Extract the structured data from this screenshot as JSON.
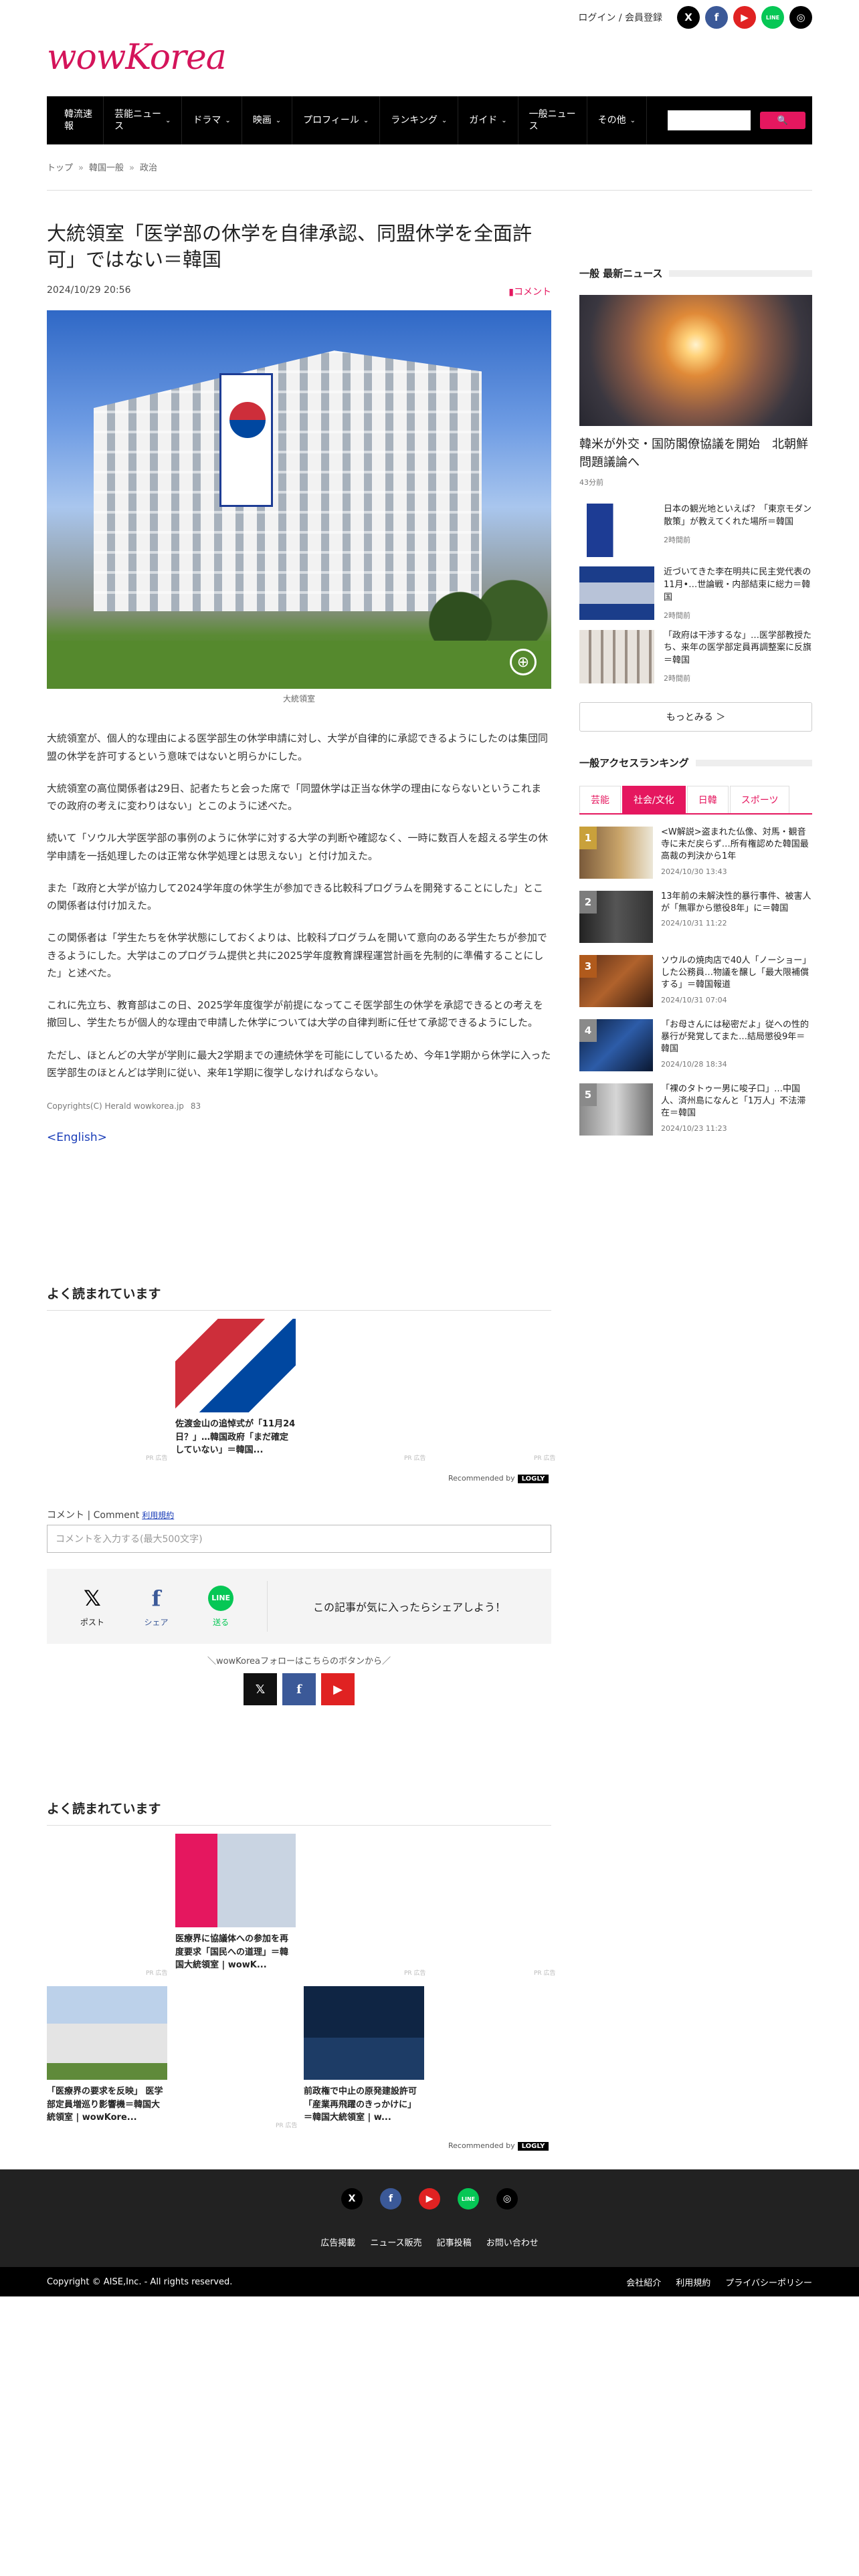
{
  "header": {
    "login_label": "ログイン / 会員登録",
    "logo": "wowKorea",
    "social": [
      "X",
      "f",
      "▶",
      "LINE",
      "◎"
    ]
  },
  "nav": {
    "items": [
      {
        "label": "韓流速\n報",
        "has_menu": false
      },
      {
        "label": "芸能ニュー\nス",
        "has_menu": true
      },
      {
        "label": "ドラマ",
        "has_menu": true
      },
      {
        "label": "映画",
        "has_menu": true
      },
      {
        "label": "プロフィール",
        "has_menu": true
      },
      {
        "label": "ランキング",
        "has_menu": true
      },
      {
        "label": "ガイド",
        "has_menu": true
      },
      {
        "label": "一般ニュー\nス",
        "has_menu": false
      },
      {
        "label": "その他",
        "has_menu": true
      }
    ],
    "search_button": "🔍"
  },
  "breadcrumb": [
    "トップ",
    "韓国一般",
    "政治"
  ],
  "article": {
    "title": "大統領室「医学部の休学を自律承認、同盟休学を全面許可」ではない＝韓国",
    "date": "2024/10/29 20:56",
    "comment_link": "コメント",
    "image_caption": "大統領室",
    "paragraphs": [
      "大統領室が、個人的な理由による医学部生の休学申請に対し、大学が自律的に承認できるようにしたのは集団同盟の休学を許可するという意味ではないと明らかにした。",
      "大統領室の高位関係者は29日、記者たちと会った席で「同盟休学は正当な休学の理由にならないというこれまでの政府の考えに変わりはない」とこのように述べた。",
      "続いて「ソウル大学医学部の事例のように休学に対する大学の判断や確認なく、一時に数百人を超える学生の休学申請を一括処理したのは正常な休学処理とは思えない」と付け加えた。",
      "また「政府と大学が協力して2024学年度の休学生が参加できる比較科プログラムを開発することにした」とこの関係者は付け加えた。",
      "この関係者は「学生たちを休学状態にしておくよりは、比較科プログラムを開いて意向のある学生たちが参加できるようにした。大学はこのプログラム提供と共に2025学年度教育課程運営計画を先制的に準備することにした」と述べた。",
      "これに先立ち、教育部はこの日、2025学年度復学が前提になってこそ医学部生の休学を承認できるとの考えを撤回し、学生たちが個人的な理由で申請した休学については大学の自律判断に任せて承認できるようにした。",
      "ただし、ほとんどの大学が学則に最大2学期までの連続休学を可能にしているため、今年1学期から休学に入った医学部生のほとんどは学則に従い、来年1学期に復学しなければならない。"
    ],
    "copyright": "Copyrights(C) Herald wowkorea.jp",
    "copyright_num": "83",
    "english_link": "<English>"
  },
  "recommend1": {
    "title": "よく読まれています",
    "cards": [
      {
        "title": "佐渡金山の追悼式が「11月24日？」…韓国政府「まだ確定していない」＝韓国..."
      }
    ],
    "pr": [
      "PR 広告",
      "PR 広告",
      "PR 広告"
    ],
    "recommended_by": "Recommended by",
    "recommended_brand": "LOGLY"
  },
  "comment": {
    "label": "コメント | Comment",
    "terms": "利用規約",
    "placeholder": "コメントを入力する(最大500文字)"
  },
  "share": {
    "buttons": [
      {
        "icon": "𝕏",
        "label": "ポスト"
      },
      {
        "icon": "f",
        "label": "シェア"
      },
      {
        "icon": "LINE",
        "label": "送る"
      }
    ],
    "message": "この記事が気に入ったらシェアしよう！",
    "follow_text": "＼wowKoreaフォローはこちらのボタンから／",
    "follow_buttons": [
      "𝕏",
      "f",
      "▶"
    ]
  },
  "recommend2": {
    "title": "よく読まれています",
    "cards": [
      {
        "title": "医療界に協議体への参加を再度要求「国民への道理」＝韓国大統領室 | wowK..."
      },
      {
        "title": "「医療界の要求を反映」 医学部定員増巡り影響機＝韓国大統領室 | wowKore..."
      },
      {
        "title": "前政権で中止の原発建設許可「産業再飛躍のきっかけに」＝韓国大統領室 | w..."
      }
    ],
    "pr": [
      "PR 広告",
      "PR 広告",
      "PR 広告",
      "PR 広告"
    ],
    "recommended_by": "Recommended by",
    "recommended_brand": "LOGLY"
  },
  "sidebar": {
    "latest_title": "一般 最新ニュース",
    "top_news": {
      "title": "韓米が外交・国防閣僚協議を開始　北朝鮮問題議論へ",
      "time": "43分前"
    },
    "news": [
      {
        "title": "日本の観光地といえば？「東京モダン散策」が教えてくれた場所＝韓国",
        "time": "2時間前"
      },
      {
        "title": "近づいてきた李在明共に民主党代表の11月•…世論戦・内部結束に総力＝韓国",
        "time": "2時間前"
      },
      {
        "title": "「政府は干渉するな」…医学部教授たち、来年の医学部定員再調整案に反旗＝韓国",
        "time": "2時間前"
      }
    ],
    "more_label": "もっとみる ＞",
    "ranking_title": "一般アクセスランキング",
    "tabs": [
      "芸能",
      "社会/文化",
      "日韓",
      "スポーツ"
    ],
    "active_tab": "社会/文化",
    "ranking": [
      {
        "num": "1",
        "title": "<W解説>盗まれた仏像、対馬・観音寺に未だ戻らず…所有権認めた韓国最高裁の判決から1年",
        "time": "2024/10/30 13:43"
      },
      {
        "num": "2",
        "title": "13年前の未解決性的暴行事件、被害人が「無罪から懲役8年」に＝韓国",
        "time": "2024/10/31 11:22"
      },
      {
        "num": "3",
        "title": "ソウルの焼肉店で40人「ノーショー」した公務員…物議を醸し「最大限補償する」＝韓国報道",
        "time": "2024/10/31 07:04"
      },
      {
        "num": "4",
        "title": "「お母さんには秘密だよ」従への性的暴行が発覚してまた…結局懲役9年＝韓国",
        "time": "2024/10/28 18:34"
      },
      {
        "num": "5",
        "title": "「裸のタトゥー男に唆子口」…中国人、済州島になんと「1万人」不法滞在＝韓国",
        "time": "2024/10/23 11:23"
      }
    ]
  },
  "footer": {
    "social": [
      "X",
      "f",
      "▶",
      "LINE",
      "◎"
    ],
    "links": [
      "広告掲載",
      "ニュース販売",
      "記事投稿",
      "お問い合わせ"
    ],
    "copyright": "Copyright © AISE,Inc. - All rights reserved.",
    "bottom_links": [
      "会社紹介",
      "利用規約",
      "プライバシーポリシー"
    ]
  },
  "colors": {
    "accent": "#e5175f",
    "nav": "#000000",
    "link": "#1a3db8"
  }
}
